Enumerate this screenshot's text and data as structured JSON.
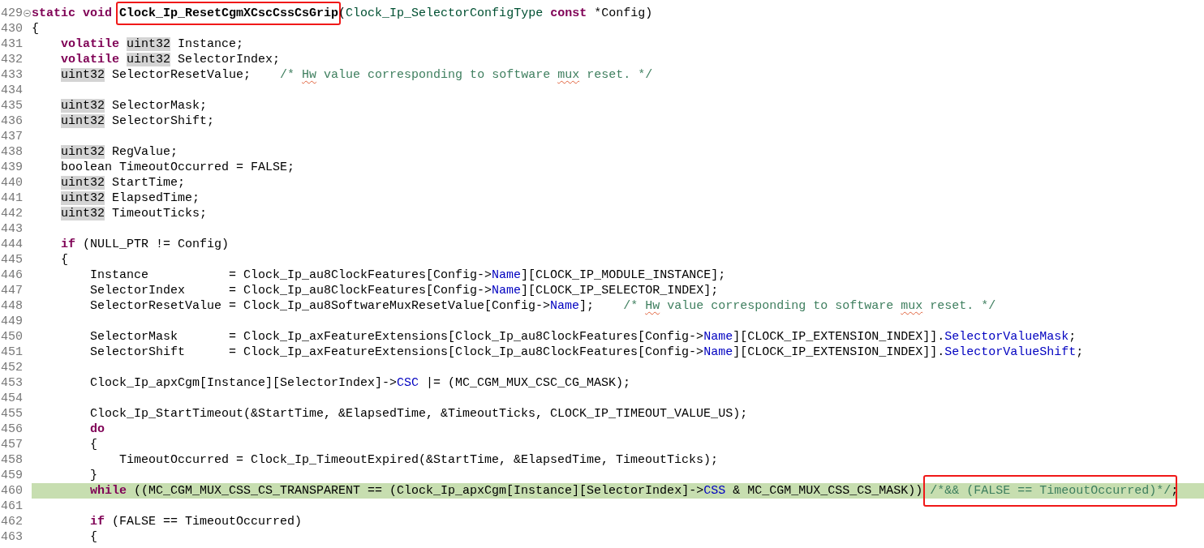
{
  "editor": {
    "lines": [
      {
        "number": "429",
        "expanded": true,
        "selected": false,
        "tokens": [
          {
            "kind": "keyword",
            "text": "static void "
          },
          {
            "kind": "function",
            "text": "Clock_Ip_ResetCgmXCscCssCsGrip",
            "marked": true
          },
          {
            "kind": "plain",
            "text": "("
          },
          {
            "kind": "typename",
            "text": "Clock_Ip_SelectorConfigType "
          },
          {
            "kind": "keyword",
            "text": "const"
          },
          {
            "kind": "plain",
            "text": " *Config)"
          }
        ]
      },
      {
        "number": "430",
        "selected": false,
        "tokens": [
          {
            "kind": "plain",
            "text": "{"
          }
        ],
        "children": [
          {
            "number": "431",
            "selected": false,
            "tokens": [
              {
                "kind": "keyword",
                "text": "volatile "
              },
              {
                "kind": "type",
                "text": "uint32"
              },
              {
                "kind": "plain",
                "text": " Instance;"
              }
            ]
          },
          {
            "number": "432",
            "selected": false,
            "tokens": [
              {
                "kind": "keyword",
                "text": "volatile "
              },
              {
                "kind": "type",
                "text": "uint32"
              },
              {
                "kind": "plain",
                "text": " SelectorIndex;"
              }
            ]
          },
          {
            "number": "433",
            "selected": false,
            "tokens": [
              {
                "kind": "type",
                "text": "uint32"
              },
              {
                "kind": "plain",
                "text": " SelectorResetValue;    "
              },
              {
                "kind": "comment",
                "text": "/* "
              },
              {
                "kind": "comment",
                "text": "Hw",
                "misspelled": true
              },
              {
                "kind": "comment",
                "text": " value corresponding to software "
              },
              {
                "kind": "comment",
                "text": "mux",
                "misspelled": true
              },
              {
                "kind": "comment",
                "text": " reset. */"
              }
            ]
          },
          {
            "number": "434",
            "selected": false
          },
          {
            "number": "435",
            "selected": false,
            "tokens": [
              {
                "kind": "type",
                "text": "uint32"
              },
              {
                "kind": "plain",
                "text": " SelectorMask;"
              }
            ]
          },
          {
            "number": "436",
            "selected": false,
            "tokens": [
              {
                "kind": "type",
                "text": "uint32"
              },
              {
                "kind": "plain",
                "text": " SelectorShift;"
              }
            ]
          },
          {
            "number": "437",
            "selected": false
          },
          {
            "number": "438",
            "selected": false,
            "tokens": [
              {
                "kind": "type",
                "text": "uint32"
              },
              {
                "kind": "plain",
                "text": " RegValue;"
              }
            ]
          },
          {
            "number": "439",
            "selected": false,
            "tokens": [
              {
                "kind": "plain",
                "text": "boolean TimeoutOccurred = FALSE;"
              }
            ]
          },
          {
            "number": "440",
            "selected": false,
            "tokens": [
              {
                "kind": "type",
                "text": "uint32"
              },
              {
                "kind": "plain",
                "text": " StartTime;"
              }
            ]
          },
          {
            "number": "441",
            "selected": false,
            "tokens": [
              {
                "kind": "type",
                "text": "uint32"
              },
              {
                "kind": "plain",
                "text": " ElapsedTime;"
              }
            ]
          },
          {
            "number": "442",
            "selected": false,
            "tokens": [
              {
                "kind": "type",
                "text": "uint32"
              },
              {
                "kind": "plain",
                "text": " TimeoutTicks;"
              }
            ]
          },
          {
            "number": "443",
            "selected": false
          },
          {
            "number": "444",
            "selected": false,
            "tokens": [
              {
                "kind": "keyword",
                "text": "if"
              },
              {
                "kind": "plain",
                "text": " (NULL_PTR != Config)"
              }
            ]
          },
          {
            "number": "445",
            "selected": false,
            "tokens": [
              {
                "kind": "plain",
                "text": "{"
              }
            ],
            "children": [
              {
                "number": "446",
                "selected": false,
                "tokens": [
                  {
                    "kind": "plain",
                    "text": "Instance           = Clock_Ip_au8ClockFeatures[Config->"
                  },
                  {
                    "kind": "field",
                    "text": "Name"
                  },
                  {
                    "kind": "plain",
                    "text": "][CLOCK_IP_MODULE_INSTANCE];"
                  }
                ]
              },
              {
                "number": "447",
                "selected": false,
                "tokens": [
                  {
                    "kind": "plain",
                    "text": "SelectorIndex      = Clock_Ip_au8ClockFeatures[Config->"
                  },
                  {
                    "kind": "field",
                    "text": "Name"
                  },
                  {
                    "kind": "plain",
                    "text": "][CLOCK_IP_SELECTOR_INDEX];"
                  }
                ]
              },
              {
                "number": "448",
                "selected": false,
                "tokens": [
                  {
                    "kind": "plain",
                    "text": "SelectorResetValue = Clock_Ip_au8SoftwareMuxResetValue[Config->"
                  },
                  {
                    "kind": "field",
                    "text": "Name"
                  },
                  {
                    "kind": "plain",
                    "text": "];    "
                  },
                  {
                    "kind": "comment",
                    "text": "/* "
                  },
                  {
                    "kind": "comment",
                    "text": "Hw",
                    "misspelled": true
                  },
                  {
                    "kind": "comment",
                    "text": " value corresponding to software "
                  },
                  {
                    "kind": "comment",
                    "text": "mux",
                    "misspelled": true
                  },
                  {
                    "kind": "comment",
                    "text": " reset. */"
                  }
                ]
              },
              {
                "number": "449",
                "selected": false
              },
              {
                "number": "450",
                "selected": false,
                "tokens": [
                  {
                    "kind": "plain",
                    "text": "SelectorMask       = Clock_Ip_axFeatureExtensions[Clock_Ip_au8ClockFeatures[Config->"
                  },
                  {
                    "kind": "field",
                    "text": "Name"
                  },
                  {
                    "kind": "plain",
                    "text": "][CLOCK_IP_EXTENSION_INDEX]]."
                  },
                  {
                    "kind": "field",
                    "text": "SelectorValueMask"
                  },
                  {
                    "kind": "plain",
                    "text": ";"
                  }
                ]
              },
              {
                "number": "451",
                "selected": false,
                "tokens": [
                  {
                    "kind": "plain",
                    "text": "SelectorShift      = Clock_Ip_axFeatureExtensions[Clock_Ip_au8ClockFeatures[Config->"
                  },
                  {
                    "kind": "field",
                    "text": "Name"
                  },
                  {
                    "kind": "plain",
                    "text": "][CLOCK_IP_EXTENSION_INDEX]]."
                  },
                  {
                    "kind": "field",
                    "text": "SelectorValueShift"
                  },
                  {
                    "kind": "plain",
                    "text": ";"
                  }
                ]
              },
              {
                "number": "452",
                "selected": false
              },
              {
                "number": "453",
                "selected": false,
                "tokens": [
                  {
                    "kind": "plain",
                    "text": "Clock_Ip_apxCgm[Instance][SelectorIndex]->"
                  },
                  {
                    "kind": "field",
                    "text": "CSC"
                  },
                  {
                    "kind": "plain",
                    "text": " |= (MC_CGM_MUX_CSC_CG_MASK);"
                  }
                ]
              },
              {
                "number": "454",
                "selected": false
              },
              {
                "number": "455",
                "selected": false,
                "tokens": [
                  {
                    "kind": "plain",
                    "text": "Clock_Ip_StartTimeout(&StartTime, &ElapsedTime, &TimeoutTicks, CLOCK_IP_TIMEOUT_VALUE_US);"
                  }
                ]
              },
              {
                "number": "456",
                "selected": false,
                "tokens": [
                  {
                    "kind": "keyword",
                    "text": "do"
                  }
                ]
              },
              {
                "number": "457",
                "selected": false,
                "tokens": [
                  {
                    "kind": "plain",
                    "text": "{"
                  }
                ],
                "children": [
                  {
                    "number": "458",
                    "selected": false,
                    "tokens": [
                      {
                        "kind": "plain",
                        "text": "TimeoutOccurred = Clock_Ip_TimeoutExpired(&StartTime, &ElapsedTime, TimeoutTicks);"
                      }
                    ]
                  }
                ]
              },
              {
                "number": "459",
                "selected": false,
                "tokens": [
                  {
                    "kind": "plain",
                    "text": "}"
                  }
                ]
              },
              {
                "number": "460",
                "selected": true,
                "tokens": [
                  {
                    "kind": "keyword",
                    "text": "while"
                  },
                  {
                    "kind": "plain",
                    "text": " ((MC_CGM_MUX_CSS_CS_TRANSPARENT == (Clock_Ip_apxCgm[Instance][SelectorIndex]->"
                  },
                  {
                    "kind": "field",
                    "text": "CSS"
                  },
                  {
                    "kind": "plain",
                    "text": " & MC_CGM_MUX_CSS_CS_MASK)) "
                  },
                  {
                    "kind": "comment",
                    "text": "/*&& (FALSE == TimeoutOccurred)*/",
                    "marked": true
                  },
                  {
                    "kind": "plain",
                    "text": ";"
                  }
                ]
              },
              {
                "number": "461",
                "selected": false
              },
              {
                "number": "462",
                "selected": false,
                "tokens": [
                  {
                    "kind": "keyword",
                    "text": "if"
                  },
                  {
                    "kind": "plain",
                    "text": " (FALSE == TimeoutOccurred)"
                  }
                ]
              },
              {
                "number": "463",
                "selected": false,
                "tokens": [
                  {
                    "kind": "plain",
                    "text": "{"
                  }
                ]
              }
            ]
          }
        ]
      }
    ]
  }
}
